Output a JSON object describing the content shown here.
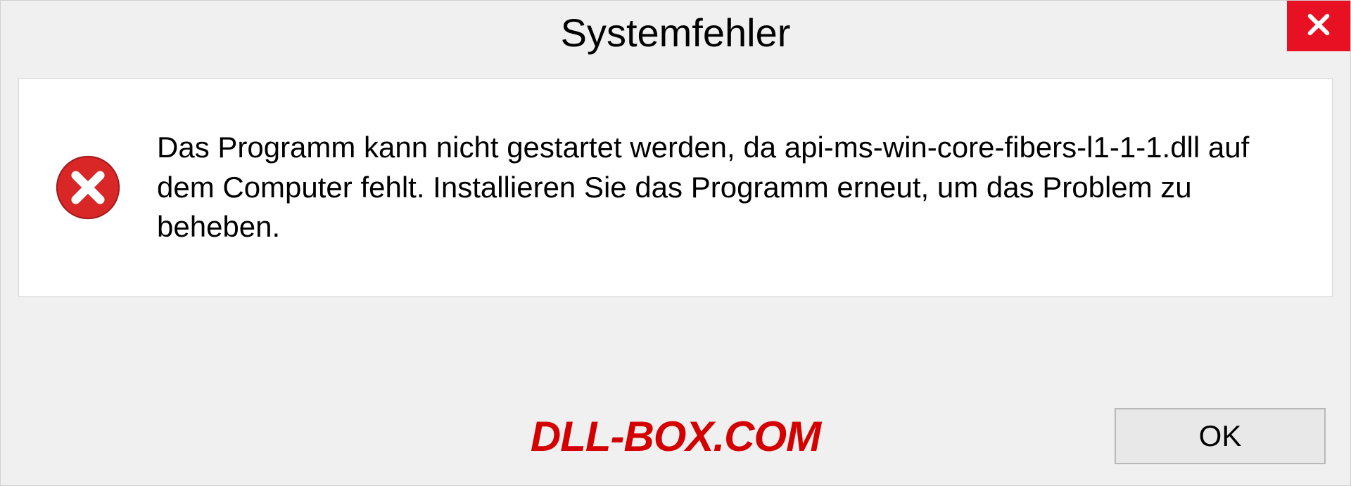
{
  "dialog": {
    "title": "Systemfehler",
    "message": "Das Programm kann nicht gestartet werden, da api-ms-win-core-fibers-l1-1-1.dll auf dem Computer fehlt. Installieren Sie das Programm erneut, um das Problem zu beheben.",
    "ok_label": "OK"
  },
  "watermark": "DLL-BOX.COM"
}
